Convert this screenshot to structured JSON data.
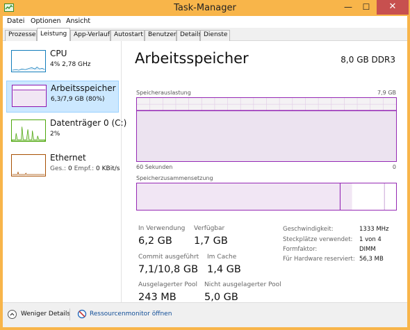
{
  "window": {
    "title": "Task-Manager",
    "controls": {
      "minimize": "—",
      "maximize": "☐",
      "close": "✕"
    },
    "accent_color": "#f8b54a"
  },
  "menu": [
    "Datei",
    "Optionen",
    "Ansicht"
  ],
  "tabs": [
    "Prozesse",
    "Leistung",
    "App-Verlauf",
    "Autostart",
    "Benutzer",
    "Details",
    "Dienste"
  ],
  "active_tab": "Leistung",
  "sidebar": {
    "items": [
      {
        "name": "CPU",
        "sub": "4% 2,78 GHz",
        "color": "#117dbb",
        "icon": "cpu-graph-icon"
      },
      {
        "name": "Arbeitsspeicher",
        "sub": "6,3/7,9 GB (80%)",
        "color": "#8b12ae",
        "icon": "memory-graph-icon"
      },
      {
        "name": "Datenträger 0 (C:)",
        "sub": "2%",
        "color": "#4da60c",
        "icon": "disk-graph-icon"
      },
      {
        "name": "Ethernet",
        "sub_send_label": "Ges.:",
        "sub_send_value": "0",
        "sub_recv_label": "Empf.:",
        "sub_recv_value": "0 KBit/s",
        "color": "#a74f01",
        "icon": "ethernet-graph-icon"
      }
    ],
    "selected_index": 1
  },
  "memory": {
    "title": "Arbeitsspeicher",
    "spec": "8,0 GB DDR3",
    "usage_graph": {
      "label": "Speicherauslastung",
      "max_label": "7,9 GB",
      "time_label": "60 Sekunden",
      "zero_label": "0",
      "fill_fraction": 0.8
    },
    "composition": {
      "label": "Speicherzusammensetzung",
      "in_use_fraction": 0.8,
      "modified_fraction": 0.83
    },
    "stats": {
      "in_use_label": "In Verwendung",
      "in_use_value": "6,2 GB",
      "available_label": "Verfügbar",
      "available_value": "1,7 GB",
      "committed_label": "Commit ausgeführt",
      "committed_value": "7,1/10,8 GB",
      "cached_label": "Im Cache",
      "cached_value": "1,4 GB",
      "paged_label": "Ausgelagerter Pool",
      "paged_value": "243 MB",
      "nonpaged_label": "Nicht ausgelagerter Pool",
      "nonpaged_value": "5,0 GB"
    },
    "details": [
      {
        "label": "Geschwindigkeit:",
        "value": "1333 MHz"
      },
      {
        "label": "Steckplätze verwendet:",
        "value": "1 von 4"
      },
      {
        "label": "Formfaktor:",
        "value": "DIMM"
      },
      {
        "label": "Für Hardware reserviert:",
        "value": "56,3 MB"
      }
    ]
  },
  "footer": {
    "fewer_details": "Weniger Details",
    "resource_monitor": "Ressourcenmonitor öffnen"
  }
}
